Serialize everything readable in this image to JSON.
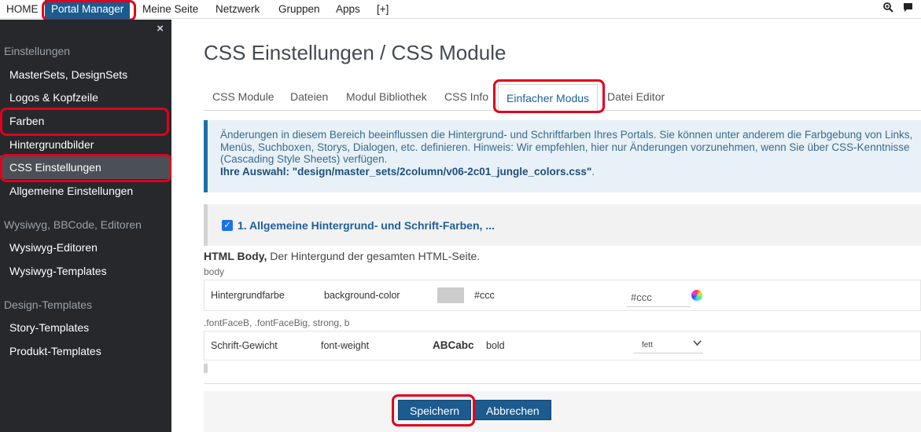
{
  "topnav": {
    "items": [
      {
        "label": "HOME"
      },
      {
        "label": "Portal Manager",
        "active": true
      },
      {
        "label": "Meine Seite"
      },
      {
        "label": "Netzwerk"
      },
      {
        "label": "Gruppen"
      },
      {
        "label": "Apps"
      },
      {
        "label": "[+]"
      }
    ],
    "icons": [
      "search-zoom-icon",
      "chat-icon"
    ]
  },
  "sidebar": {
    "close_glyph": "×",
    "sections": [
      {
        "title": "Einstellungen",
        "items": [
          "MasterSets, DesignSets",
          "Logos & Kopfzeile",
          "Farben",
          "Hintergrundbilder",
          "CSS Einstellungen",
          "Allgemeine Einstellungen"
        ]
      },
      {
        "title": "Wysiwyg, BBCode, Editoren",
        "items": [
          "Wysiwyg-Editoren",
          "Wysiwyg-Templates"
        ]
      },
      {
        "title": "Design-Templates",
        "items": [
          "Story-Templates",
          "Produkt-Templates"
        ]
      }
    ],
    "active_item": "CSS Einstellungen"
  },
  "main": {
    "title": "CSS Einstellungen / CSS Module",
    "tabs": [
      "CSS Module",
      "Dateien",
      "Modul Bibliothek",
      "CSS Info",
      "Einfacher Modus",
      "Datei Editor"
    ],
    "active_tab": "Einfacher Modus",
    "info": {
      "text": "Änderungen in diesem Bereich beeinflussen die Hintergrund- und Schriftfarben Ihres Portals. Sie können unter anderem die Farbgebung von Links, Menüs, Suchboxen, Storys, Dialogen, etc. definieren. Hinweis: Wir empfehlen, hier nur Änderungen vorzunehmen, wenn Sie über CSS-Kenntnisse (Cascading Style Sheets) verfügen.",
      "selection_label": "Ihre Auswahl: \"design/master_sets/2column/v06-2c01_jungle_colors.css\"",
      "selection_suffix": "."
    },
    "accordion": {
      "checked": true,
      "title": "1. Allgemeine Hintergrund- und Schrift-Farben, ..."
    },
    "section": {
      "heading_bold": "HTML Body,",
      "heading_rest": " Der Hintergund der gesamten HTML-Seite.",
      "selector1": "body",
      "row1": {
        "label": "Hintergrundfarbe",
        "property": "background-color",
        "value": "#ccc",
        "input_value": "#ccc",
        "swatch_color": "#cccccc"
      },
      "selector2": ".fontFaceB, .fontFaceBig, strong, b",
      "row2": {
        "label": "Schrift-Gewicht",
        "property": "font-weight",
        "sample": "ABCabc",
        "value": "bold",
        "select_value": "fett"
      }
    },
    "buttons": {
      "save": "Speichern",
      "cancel": "Abbrechen"
    }
  },
  "colors": {
    "accent": "#1b5b8f",
    "sidebar_bg": "#26282c",
    "highlight_ring": "#e1001b",
    "info_bg": "#e8f1f7"
  }
}
